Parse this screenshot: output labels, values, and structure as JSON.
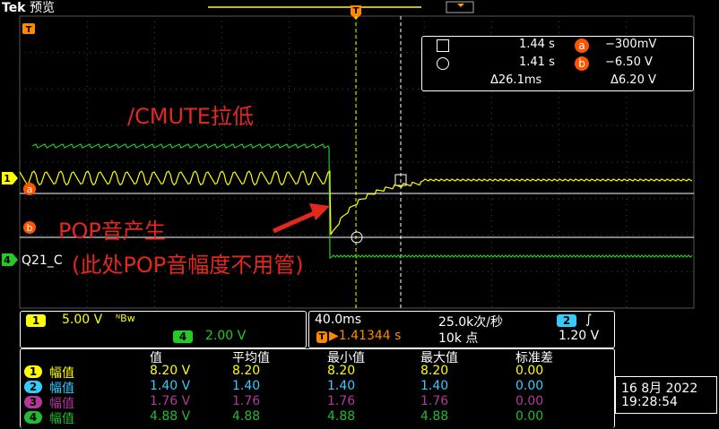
{
  "header": {
    "brand": "Tek",
    "mode": "预览",
    "trigger_marker": "T",
    "left_marker": "T"
  },
  "cursors": {
    "row1": {
      "time": "1.44 s",
      "label": "a",
      "value": "−300mV"
    },
    "row2": {
      "time": "1.41 s",
      "label": "b",
      "value": "−6.50 V"
    },
    "row3": {
      "dtime": "Δ26.1ms",
      "dvalue": "Δ6.20 V"
    }
  },
  "annotations": {
    "cmute": "/CMUTE拉低",
    "pop": "POP音产生",
    "pop_amp": "(此处POP音幅度不用管)"
  },
  "channel_markers": {
    "ch1": "1",
    "a": "a",
    "b": "b",
    "ch4": "4",
    "ch4_label": "Q21_C"
  },
  "settings": {
    "ch1_index": "1",
    "ch1_scale": "5.00 V",
    "ch1_bw": "ᴺBw",
    "ch4_index": "4",
    "ch4_scale": "2.00 V",
    "timebase": "40.0ms",
    "sample_rate": "25.0k次/秒",
    "trig_pos_icon": "T",
    "trig_pos": "▶1.41344 s",
    "record_len": "10k 点",
    "trig_source": "2",
    "trig_slope": "∫",
    "trig_level": "1.20 V"
  },
  "measurements": {
    "headers": [
      "值",
      "平均值",
      "最小值",
      "最大值",
      "标准差"
    ],
    "rows": [
      {
        "ch": "1",
        "name": "幅值",
        "values": [
          "8.20 V",
          "8.20",
          "8.20",
          "8.20",
          "0.00"
        ],
        "color": "#ffff00"
      },
      {
        "ch": "2",
        "name": "幅值",
        "values": [
          "1.40 V",
          "1.40",
          "1.40",
          "1.40",
          "0.00"
        ],
        "color": "#33ccff"
      },
      {
        "ch": "3",
        "name": "幅值",
        "values": [
          "1.76 V",
          "1.76",
          "1.76",
          "1.76",
          "0.00"
        ],
        "color": "#b3389a"
      },
      {
        "ch": "4",
        "name": "幅值",
        "values": [
          "4.88 V",
          "4.88",
          "4.88",
          "4.88",
          "0.00"
        ],
        "color": "#22bb33"
      }
    ]
  },
  "datetime": {
    "date": "16 8月  2022",
    "time": "19:28:54"
  },
  "colors": {
    "ch1": "#ffff00",
    "ch4": "#22cc22",
    "cursor_bg": "#ff5500",
    "annotation": "#e3281f"
  }
}
